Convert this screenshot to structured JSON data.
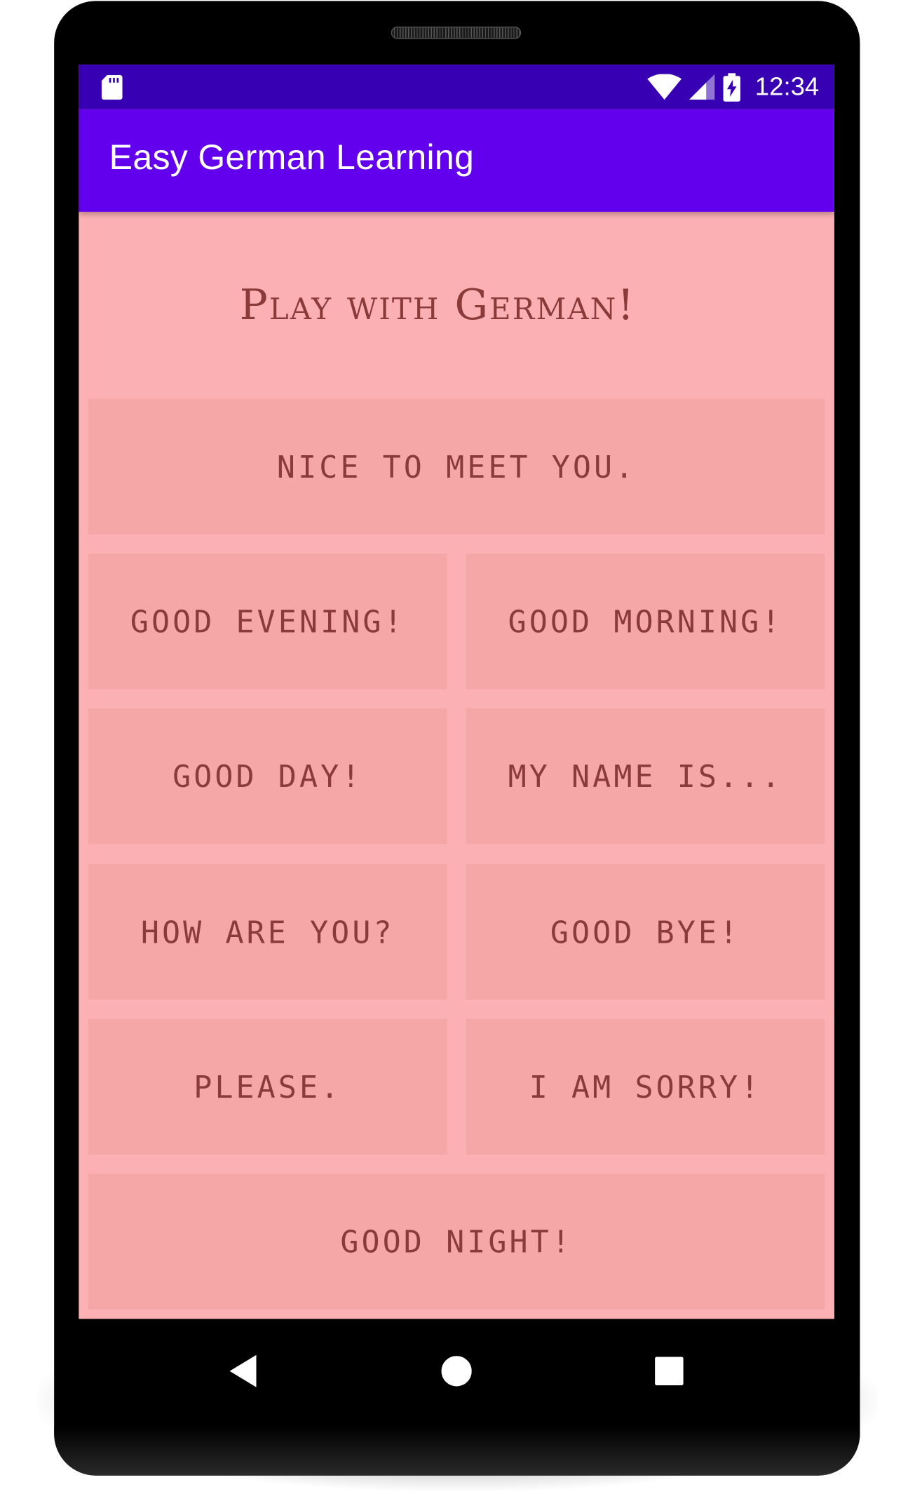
{
  "status_bar": {
    "time": "12:34",
    "icons": [
      "sd-card-icon",
      "wifi-icon",
      "signal-icon",
      "battery-charging-icon"
    ]
  },
  "app_bar": {
    "title": "Easy German Learning"
  },
  "main": {
    "heading": "Play with German!",
    "phrases": [
      "NICE TO MEET YOU.",
      "GOOD EVENING!",
      "GOOD MORNING!",
      "GOOD DAY!",
      "MY NAME IS...",
      "HOW ARE YOU?",
      "GOOD BYE!",
      "PLEASE.",
      "I AM SORRY!",
      "GOOD NIGHT!"
    ]
  },
  "navigation": {
    "icons": [
      "back-icon",
      "home-icon",
      "recents-icon"
    ]
  },
  "colors": {
    "status_bar": "#3700b3",
    "app_bar": "#6200ee",
    "background": "#fbb1b4",
    "button": "#f5a7a8",
    "text": "#8b3a3a"
  }
}
